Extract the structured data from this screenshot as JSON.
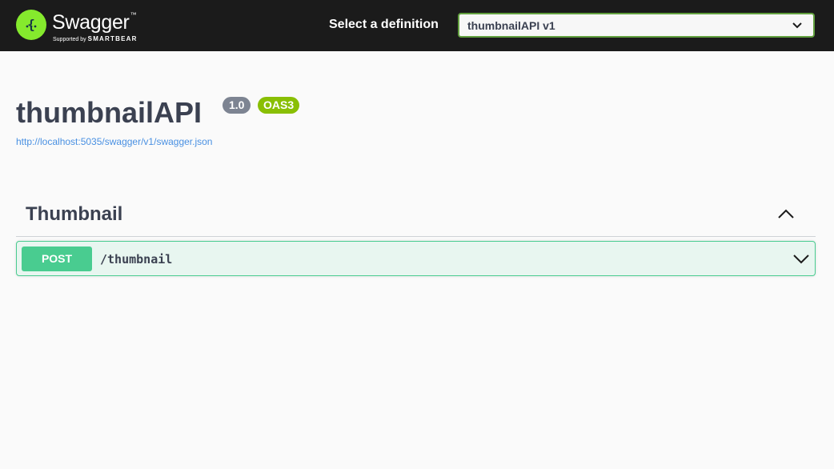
{
  "header": {
    "logo": {
      "name": "Swagger",
      "trademark": "™",
      "supported_by": "Supported by",
      "brand": "SMARTBEAR",
      "icon": "swagger-logo-icon",
      "color": "#85ea2d"
    },
    "definition_label": "Select a definition",
    "definition_selected": "thumbnailAPI v1",
    "dropdown_icon": "chevron-down-icon"
  },
  "info": {
    "title": "thumbnailAPI",
    "version": "1.0",
    "oas_badge": "OAS3",
    "spec_url": "http://localhost:5035/swagger/v1/swagger.json"
  },
  "tags": [
    {
      "name": "Thumbnail",
      "toggle_icon": "chevron-up-icon",
      "expanded": true,
      "operations": [
        {
          "method": "POST",
          "path": "/thumbnail",
          "toggle_icon": "chevron-down-icon",
          "color": "#49cc90"
        }
      ]
    }
  ],
  "colors": {
    "topbar": "#1b1b1b",
    "accent_green": "#89bf04",
    "post": "#49cc90",
    "link": "#4990e2",
    "text": "#3b4151"
  }
}
